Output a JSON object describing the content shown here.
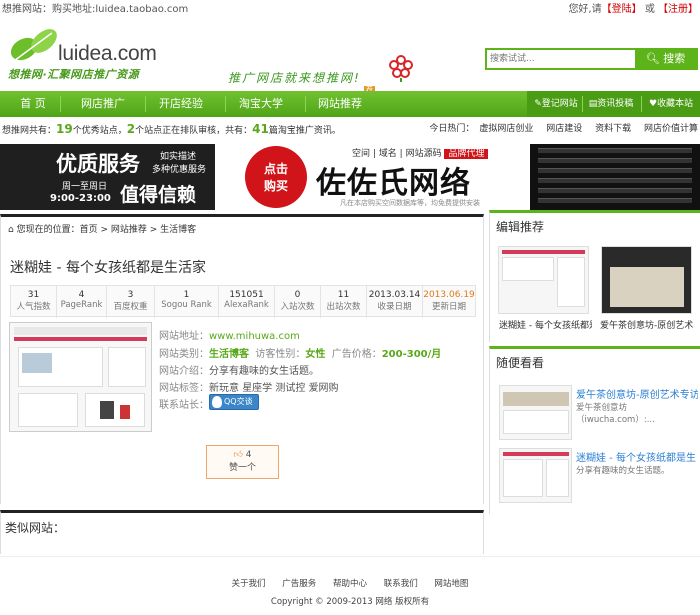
{
  "topbar": {
    "left": "想推网站：购买地址:luidea.taobao.com",
    "greet": "您好,请",
    "login": "【登陆】",
    "or": "或",
    "register": "【注册】"
  },
  "logo": {
    "en": "luidea.com",
    "cn": "想推网·汇聚网店推广资源"
  },
  "slogan": "推广网店就来想推网!",
  "slogan_badge": "荐",
  "search": {
    "placeholder": "搜索试试...",
    "button": "搜索"
  },
  "nav": {
    "items": [
      "首 页",
      "网店推广",
      "开店经验",
      "淘宝大学",
      "网站推荐"
    ],
    "right": [
      "登记网站",
      "资讯投稿",
      "收藏本站"
    ]
  },
  "stats": {
    "prefix": "想推网共有：",
    "n1": "19",
    "t1": "个优秀站点，",
    "n2": "2",
    "t2": "个站点正在排队审核，共有：",
    "n3": "41",
    "t3": "篇淘宝推广资讯。",
    "hot_label": "今日热门：",
    "hot": [
      "虚拟网店创业",
      "网店建设",
      "资料下载",
      "网店价值计算"
    ]
  },
  "banner": {
    "l1": "优质服务",
    "l1b": "如实描述",
    "l1c": "多种优惠服务",
    "l2": "周一至周日",
    "l3": "9:00-23:00",
    "l4": "值得信赖",
    "red1": "点击",
    "red2": "购买",
    "tags": [
      "空间",
      "域名",
      "网站源码",
      "品牌代理"
    ],
    "big": "佐佐氏网络",
    "small": "凡在本店购买空间数据库等，均免费提供安装"
  },
  "crumb": [
    "您现在的位置：",
    "首页",
    "网站推荐",
    "生活博客"
  ],
  "site": {
    "title": "迷糊娃 - 每个女孩纸都是生活家",
    "stats": [
      {
        "v": "31",
        "k": "人气指数"
      },
      {
        "v": "4",
        "k": "PageRank"
      },
      {
        "v": "3",
        "k": "百度权重"
      },
      {
        "v": "1",
        "k": "Sogou Rank"
      },
      {
        "v": "151051",
        "k": "AlexaRank"
      },
      {
        "v": "0",
        "k": "入站次数"
      },
      {
        "v": "11",
        "k": "出站次数"
      },
      {
        "v": "2013.03.14",
        "k": "收录日期"
      },
      {
        "v": "2013.06.19",
        "k": "更新日期"
      }
    ],
    "url_label": "网站地址：",
    "url": "www.mihuwa.com",
    "cat_label": "网站类别：",
    "cat": "生活博客",
    "gender_label": "访客性别：",
    "gender": "女性",
    "price_label": "广告价格：",
    "price": "200-300/月",
    "intro_label": "网站介绍：",
    "intro": "分享有趣味的女生话题。",
    "tags_label": "网站标签：",
    "tags": [
      "新玩意",
      "星座学",
      "测试控",
      "爱网购"
    ],
    "contact_label": "联系站长：",
    "qq": "QQ交谈",
    "vote_count": "4",
    "vote_label": "赞一个"
  },
  "similar_title": "类似网站：",
  "side": {
    "editor_title": "编辑推荐",
    "editor": [
      "迷糊娃 - 每个女孩纸都是",
      "爱午茶创意坊-原创艺术专"
    ],
    "random_title": "随便看看",
    "random": [
      {
        "t": "爱午茶创意坊-原创艺术专访",
        "d": "爱午茶创意坊（iwucha.com）:..."
      },
      {
        "t": "迷糊娃 - 每个女孩纸都是生",
        "d": "分享有趣味的女生话题。"
      }
    ]
  },
  "footer": {
    "links": [
      "关于我们",
      "广告服务",
      "帮助中心",
      "联系我们",
      "网站地图"
    ],
    "copy": "Copyright © 2009-2013 网络 版权所有"
  },
  "colors": {
    "accent": "#5cb31a",
    "dark": "#222222",
    "banner_red": "#d0141a",
    "date_orange": "#e07a1a"
  }
}
